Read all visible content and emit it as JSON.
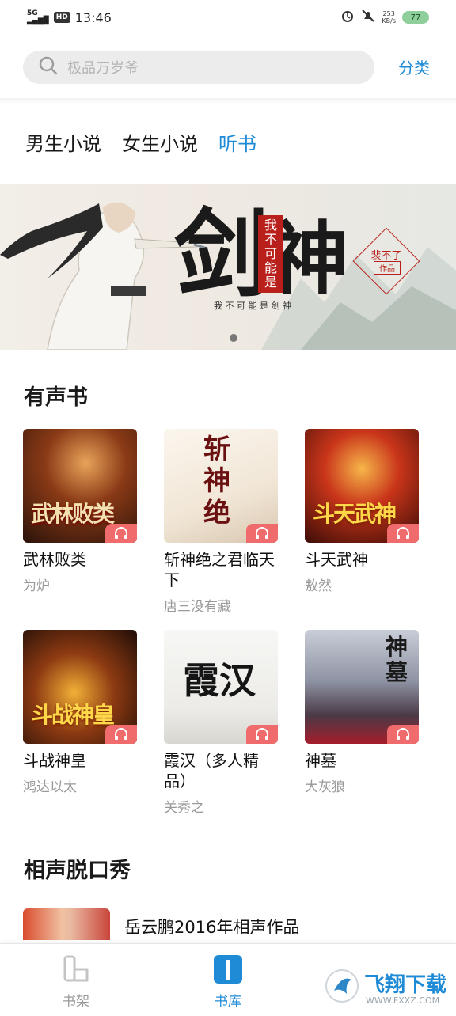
{
  "status_bar": {
    "network": "5G",
    "hd": "HD",
    "time": "13:46",
    "speed_value": "253",
    "speed_unit": "KB/s",
    "battery": "77"
  },
  "search": {
    "placeholder": "极品万岁爷",
    "category_label": "分类"
  },
  "tabs": [
    {
      "label": "男生小说",
      "active": false
    },
    {
      "label": "女生小说",
      "active": false
    },
    {
      "label": "听书",
      "active": true
    }
  ],
  "banner": {
    "title_main_1": "剑",
    "title_main_2": "神",
    "title_seal": "我不可能是",
    "subtitle": "我 不 可 能 是 剑 神",
    "author_tag_1": "裴不了",
    "author_tag_2": "作品"
  },
  "audiobooks": {
    "section_title": "有声书",
    "items": [
      {
        "title": "武林败类",
        "author": "为炉",
        "cover_text": "武林败类"
      },
      {
        "title": "斩神绝之君临天下",
        "author": "唐三没有藏",
        "cover_text": "斩神绝"
      },
      {
        "title": "斗天武神",
        "author": "敖然",
        "cover_text": "斗天武神"
      },
      {
        "title": "斗战神皇",
        "author": "鸿达以太",
        "cover_text": "斗战神皇"
      },
      {
        "title": "霞汉（多人精品）",
        "author": "关秀之",
        "cover_text": "霞汉"
      },
      {
        "title": "神墓",
        "author": "大灰狼",
        "cover_text": "神墓"
      }
    ]
  },
  "crosstalk": {
    "section_title": "相声脱口秀",
    "items": [
      {
        "title": "岳云鹏2016年相声作品"
      }
    ]
  },
  "bottom_nav": [
    {
      "label": "书架",
      "active": false
    },
    {
      "label": "书库",
      "active": true
    }
  ],
  "watermark": {
    "text": "飞翔下载",
    "url": "WWW.FXXZ.COM"
  },
  "colors": {
    "accent": "#1f8bd6",
    "badge": "#f06b6b"
  }
}
